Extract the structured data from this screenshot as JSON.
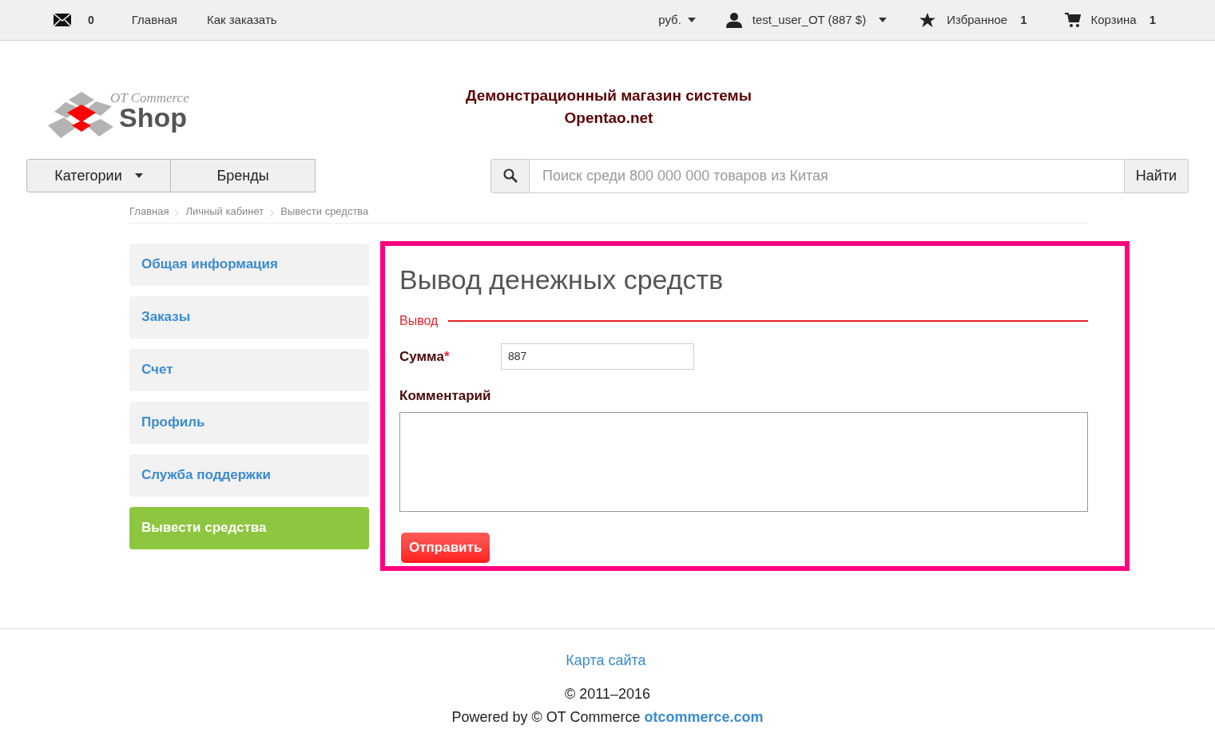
{
  "topbar": {
    "messages_count": "0",
    "links": [
      "Главная",
      "Как заказать"
    ],
    "currency": "руб.",
    "user": "test_user_OT (887 $)",
    "favorites": {
      "label": "Избранное",
      "count": "1"
    },
    "cart": {
      "label": "Корзина",
      "count": "1"
    }
  },
  "logo": {
    "line1": "OT Commerce",
    "line2": "Shop"
  },
  "header_title": [
    "Демонстрационный магазин системы",
    "Opentao.net"
  ],
  "nav": [
    {
      "label": "Категории",
      "dropdown": true
    },
    {
      "label": "Бренды",
      "dropdown": false
    }
  ],
  "search": {
    "placeholder": "Поиск среди 800 000 000 товаров из Китая",
    "button": "Найти"
  },
  "breadcrumbs": [
    "Главная",
    "Личный кабинет",
    "Вывести средства"
  ],
  "sidebar": [
    {
      "label": "Общая информация",
      "selected": false
    },
    {
      "label": "Заказы",
      "selected": false
    },
    {
      "label": "Счет",
      "selected": false
    },
    {
      "label": "Профиль",
      "selected": false
    },
    {
      "label": "Служба поддержки",
      "selected": false
    },
    {
      "label": "Вывести средства",
      "selected": true
    }
  ],
  "form": {
    "title": "Вывод денежных средств",
    "section": "Вывод",
    "fields": [
      {
        "kind": "input",
        "label": "Сумма",
        "required_mark": "*",
        "value": "887"
      },
      {
        "kind": "textarea",
        "label": "Комментарий"
      }
    ],
    "submit": "Отправить"
  },
  "footer": {
    "sitemap": "Карта сайта",
    "copyright": "© 2011–2016",
    "powered_by": "Powered by © OT Commerce",
    "powered_link": "otcommerce.com"
  }
}
